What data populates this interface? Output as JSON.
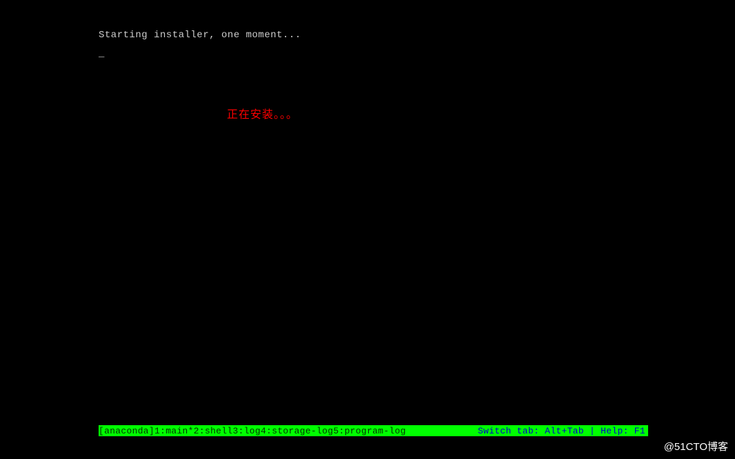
{
  "terminal": {
    "status_text": "Starting installer, one moment...",
    "cursor": "_",
    "installing": "正在安装。。。"
  },
  "bottombar": {
    "prefix": "[anaconda]",
    "tabs": [
      {
        "num": "1",
        "label": "main*"
      },
      {
        "num": "2",
        "label": "shell"
      },
      {
        "num": "3",
        "label": "log"
      },
      {
        "num": "4",
        "label": "storage-log"
      },
      {
        "num": "5",
        "label": "program-log"
      }
    ],
    "switch_text": "Switch tab: Alt+Tab | Help: F1"
  },
  "watermark": "@51CTO博客"
}
